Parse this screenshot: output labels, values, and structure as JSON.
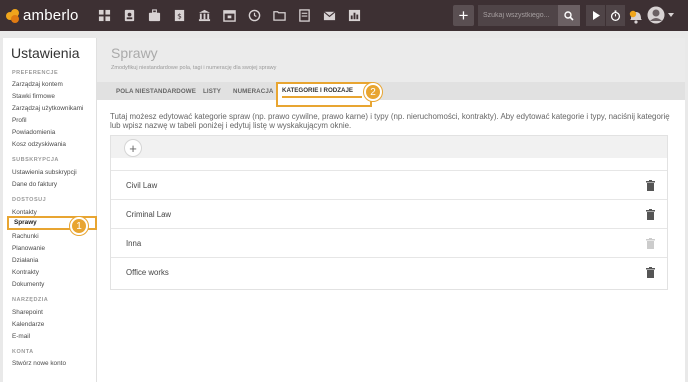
{
  "brand": {
    "name": "amberlo"
  },
  "topbar": {
    "search_placeholder": "Szukaj wszystkiego...",
    "add_label": "+"
  },
  "sidebar": {
    "title": "Ustawienia",
    "sections": [
      {
        "heading": "PREFERENCJE",
        "items": [
          "Zarządzaj kontem",
          "Stawki firmowe",
          "Zarządzaj użytkownikami",
          "Profil",
          "Powiadomienia",
          "Kosz odzyskiwania"
        ]
      },
      {
        "heading": "SUBSKRYPCJA",
        "items": [
          "Ustawienia subskrypcji",
          "Dane do faktury"
        ]
      },
      {
        "heading": "DOSTOSUJ",
        "items": [
          "Kontakty",
          "Sprawy",
          "Rachunki",
          "Planowanie",
          "Działania",
          "Kontrakty",
          "Dokumenty"
        ]
      },
      {
        "heading": "NARZĘDZIA",
        "items": [
          "Sharepoint",
          "Kalendarze",
          "E-mail"
        ]
      },
      {
        "heading": "KONTA",
        "items": [
          "Stwórz nowe konto"
        ]
      }
    ],
    "active_item": "Sprawy"
  },
  "main": {
    "title": "Sprawy",
    "subtitle": "Zmodyfikuj niestandardowe pola, tagi i numerację dla swojej sprawy",
    "tabs": [
      "POLA NIESTANDARDOWE",
      "LISTY",
      "NUMERACJA",
      "KATEGORIE I RODZAJE"
    ],
    "active_tab": "KATEGORIE I RODZAJE",
    "description": "Tutaj możesz edytować kategorie spraw (np. prawo cywilne, prawo karne) i typy (np. nieruchomości, kontrakty). Aby edytować kategorie i typy, naciśnij kategorię lub wpisz nazwę w tabeli poniżej i edytuj listę w wyskakującym oknie.",
    "add_symbol": "+",
    "categories": [
      {
        "name": "Civil Law",
        "deletable": true
      },
      {
        "name": "Criminal Law",
        "deletable": true
      },
      {
        "name": "Inna",
        "deletable": false
      },
      {
        "name": "Office works",
        "deletable": true
      }
    ]
  },
  "badges": [
    "1",
    "2"
  ],
  "colors": {
    "accent": "#e8a531",
    "topbar": "#3d3033",
    "logo": "#f0a51c"
  }
}
